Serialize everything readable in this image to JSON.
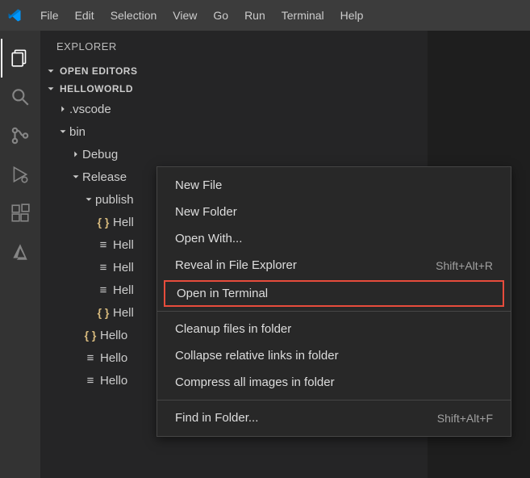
{
  "menubar": {
    "items": [
      "File",
      "Edit",
      "Selection",
      "View",
      "Go",
      "Run",
      "Terminal",
      "Help"
    ]
  },
  "sidebar": {
    "title": "EXPLORER",
    "sections": {
      "openEditors": "OPEN EDITORS",
      "workspace": "HELLOWORLD"
    }
  },
  "tree": {
    "vscode": ".vscode",
    "bin": "bin",
    "debug": "Debug",
    "release": "Release",
    "publish": "publish",
    "files": [
      "Hell",
      "Hell",
      "Hell",
      "Hell",
      "Hell",
      "Hello",
      "Hello",
      "Hello"
    ]
  },
  "contextMenu": {
    "newFile": "New File",
    "newFolder": "New Folder",
    "openWith": "Open With...",
    "revealExplorer": "Reveal in File Explorer",
    "revealExplorerShortcut": "Shift+Alt+R",
    "openTerminal": "Open in Terminal",
    "cleanup": "Cleanup files in folder",
    "collapse": "Collapse relative links in folder",
    "compress": "Compress all images in folder",
    "findInFolder": "Find in Folder...",
    "findInFolderShortcut": "Shift+Alt+F"
  }
}
